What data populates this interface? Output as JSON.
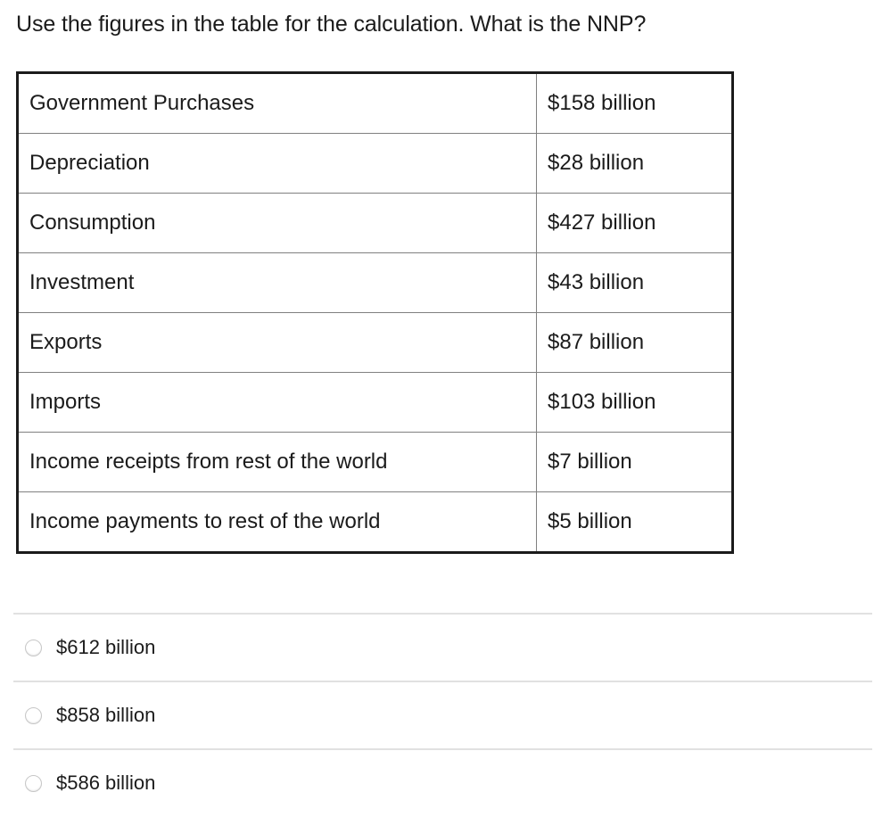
{
  "question": {
    "text": "Use the figures in the table for the calculation. What is the NNP?"
  },
  "table": {
    "rows": [
      {
        "label": "Government Purchases",
        "value": "$158 billion"
      },
      {
        "label": "Depreciation",
        "value": "$28 billion"
      },
      {
        "label": "Consumption",
        "value": "$427 billion"
      },
      {
        "label": "Investment",
        "value": "$43 billion"
      },
      {
        "label": "Exports",
        "value": "$87 billion"
      },
      {
        "label": "Imports",
        "value": "$103 billion"
      },
      {
        "label": "Income receipts from rest of the world",
        "value": "$7 billion"
      },
      {
        "label": "Income payments to rest of the world",
        "value": "$5 billion"
      }
    ]
  },
  "answers": {
    "options": [
      {
        "label": "$612 billion",
        "selected": false
      },
      {
        "label": "$858 billion",
        "selected": false
      },
      {
        "label": "$586 billion",
        "selected": false
      }
    ]
  },
  "colors": {
    "table_outer_border": "#1b1b1b",
    "table_inner_border": "#808080",
    "text": "#1b1b1b",
    "divider": "#e1e1e1",
    "radio_border": "#c7c7c7",
    "background": "#ffffff"
  }
}
